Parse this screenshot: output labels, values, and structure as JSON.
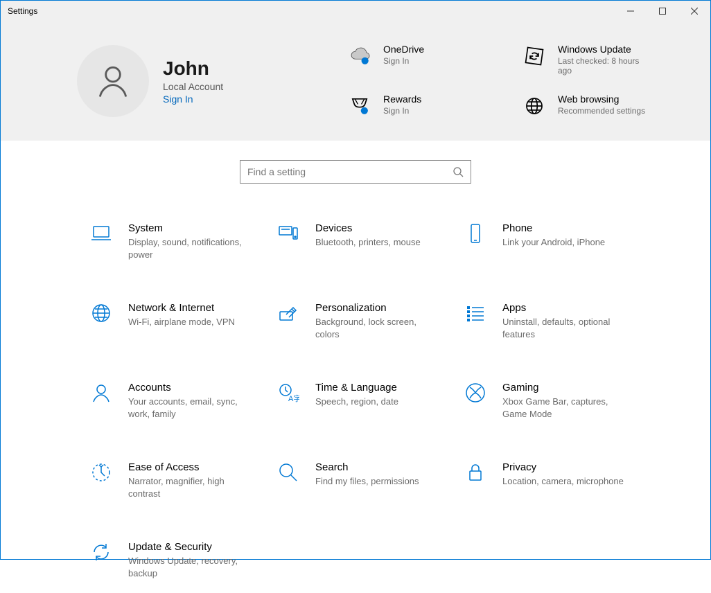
{
  "window": {
    "title": "Settings"
  },
  "profile": {
    "name": "John",
    "account_type": "Local Account",
    "signin_label": "Sign In"
  },
  "hero": {
    "onedrive": {
      "title": "OneDrive",
      "sub": "Sign In"
    },
    "update": {
      "title": "Windows Update",
      "sub": "Last checked: 8 hours ago"
    },
    "rewards": {
      "title": "Rewards",
      "sub": "Sign In"
    },
    "web": {
      "title": "Web browsing",
      "sub": "Recommended settings"
    }
  },
  "search": {
    "placeholder": "Find a setting"
  },
  "categories": [
    {
      "id": "system",
      "title": "System",
      "sub": "Display, sound, notifications, power"
    },
    {
      "id": "devices",
      "title": "Devices",
      "sub": "Bluetooth, printers, mouse"
    },
    {
      "id": "phone",
      "title": "Phone",
      "sub": "Link your Android, iPhone"
    },
    {
      "id": "network",
      "title": "Network & Internet",
      "sub": "Wi-Fi, airplane mode, VPN"
    },
    {
      "id": "personalization",
      "title": "Personalization",
      "sub": "Background, lock screen, colors"
    },
    {
      "id": "apps",
      "title": "Apps",
      "sub": "Uninstall, defaults, optional features"
    },
    {
      "id": "accounts",
      "title": "Accounts",
      "sub": "Your accounts, email, sync, work, family"
    },
    {
      "id": "time",
      "title": "Time & Language",
      "sub": "Speech, region, date"
    },
    {
      "id": "gaming",
      "title": "Gaming",
      "sub": "Xbox Game Bar, captures, Game Mode"
    },
    {
      "id": "ease",
      "title": "Ease of Access",
      "sub": "Narrator, magnifier, high contrast"
    },
    {
      "id": "search",
      "title": "Search",
      "sub": "Find my files, permissions"
    },
    {
      "id": "privacy",
      "title": "Privacy",
      "sub": "Location, camera, microphone"
    },
    {
      "id": "update",
      "title": "Update & Security",
      "sub": "Windows Update, recovery, backup"
    }
  ],
  "colors": {
    "accent": "#0078d4",
    "link": "#0066bb"
  }
}
